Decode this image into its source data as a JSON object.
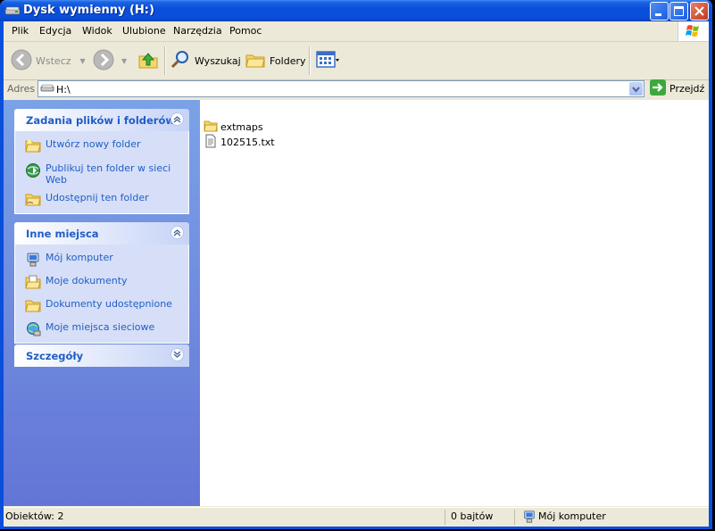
{
  "window": {
    "title": "Dysk wymienny (H:)"
  },
  "menu": [
    "Plik",
    "Edycja",
    "Widok",
    "Ulubione",
    "Narzędzia",
    "Pomoc"
  ],
  "toolbar": {
    "back_label": "Wstecz",
    "search_label": "Wyszukaj",
    "folders_label": "Foldery"
  },
  "address": {
    "label": "Adres",
    "value": "H:\\",
    "go_label": "Przejdź"
  },
  "panels": {
    "tasks": {
      "title": "Zadania plików i folderów",
      "items": [
        "Utwórz nowy folder",
        "Publikuj ten folder w sieci Web",
        "Udostępnij ten folder"
      ]
    },
    "places": {
      "title": "Inne miejsca",
      "items": [
        "Mój komputer",
        "Moje dokumenty",
        "Dokumenty udostępnione",
        "Moje miejsca sieciowe"
      ]
    },
    "details": {
      "title": "Szczegóły"
    }
  },
  "files": [
    {
      "name": "extmaps",
      "type": "folder"
    },
    {
      "name": "102515.txt",
      "type": "text-file"
    }
  ],
  "status": {
    "objects": "Obiektów: 2",
    "size": "0 bajtów",
    "location": "Mój komputer"
  },
  "icons": {
    "title": "drive-icon",
    "back": "back-arrow-icon",
    "forward": "forward-arrow-icon",
    "up": "folder-up-icon",
    "search": "magnifier-icon",
    "folders": "folders-icon",
    "views": "views-icon",
    "go": "go-arrow-icon"
  },
  "colors": {
    "title_bar": "#0A4EDC",
    "task_link": "#215DC6",
    "task_pane": "#6375D6"
  }
}
